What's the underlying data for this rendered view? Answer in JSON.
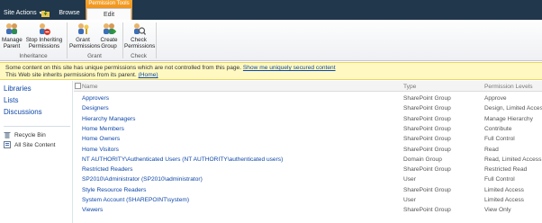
{
  "topbar": {
    "site_actions": "Site Actions",
    "browse_tab": "Browse",
    "context_group": "Permission Tools",
    "edit_tab": "Edit"
  },
  "ribbon": {
    "buttons": [
      {
        "line1": "Manage",
        "line2": "Parent",
        "icon": "manage-parent-icon"
      },
      {
        "line1": "Stop Inheriting",
        "line2": "Permissions",
        "icon": "stop-inheriting-icon"
      },
      {
        "line1": "Grant",
        "line2": "Permissions",
        "icon": "grant-permissions-icon"
      },
      {
        "line1": "Create",
        "line2": "Group",
        "icon": "create-group-icon"
      },
      {
        "line1": "Check",
        "line2": "Permissions",
        "icon": "check-permissions-icon"
      }
    ],
    "groups": [
      "Inheritance",
      "Grant",
      "Check"
    ]
  },
  "status": {
    "line1_text": "Some content on this site has unique permissions which are not controlled from this page.",
    "line1_link": "Show me uniquely secured content",
    "line2_text": "This Web site inherits permissions from its parent.",
    "line2_link": "(Home)"
  },
  "leftnav": {
    "headings": [
      "Libraries",
      "Lists",
      "Discussions"
    ],
    "recycle_bin": "Recycle Bin",
    "all_site_content": "All Site Content"
  },
  "table": {
    "columns": {
      "name": "Name",
      "type": "Type",
      "permission": "Permission Levels"
    },
    "rows": [
      {
        "name": "Approvers",
        "type": "SharePoint Group",
        "perm": "Approve"
      },
      {
        "name": "Designers",
        "type": "SharePoint Group",
        "perm": "Design, Limited Access"
      },
      {
        "name": "Hierarchy Managers",
        "type": "SharePoint Group",
        "perm": "Manage Hierarchy"
      },
      {
        "name": "Home Members",
        "type": "SharePoint Group",
        "perm": "Contribute"
      },
      {
        "name": "Home Owners",
        "type": "SharePoint Group",
        "perm": "Full Control"
      },
      {
        "name": "Home Visitors",
        "type": "SharePoint Group",
        "perm": "Read"
      },
      {
        "name": "NT AUTHORITY\\Authenticated Users (NT AUTHORITY\\authenticated users)",
        "type": "Domain Group",
        "perm": "Read, Limited Access"
      },
      {
        "name": "Restricted Readers",
        "type": "SharePoint Group",
        "perm": "Restricted Read"
      },
      {
        "name": "SP2010\\Administrator (SP2010\\administrator)",
        "type": "User",
        "perm": "Full Control"
      },
      {
        "name": "Style Resource Readers",
        "type": "SharePoint Group",
        "perm": "Limited Access"
      },
      {
        "name": "System Account (SHAREPOINT\\system)",
        "type": "User",
        "perm": "Limited Access"
      },
      {
        "name": "Viewers",
        "type": "SharePoint Group",
        "perm": "View Only"
      }
    ]
  }
}
